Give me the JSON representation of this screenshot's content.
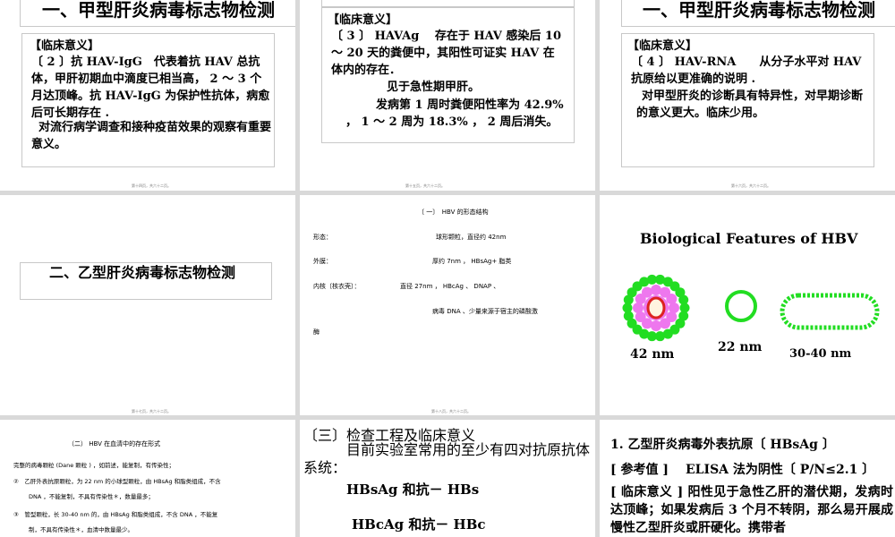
{
  "slide1": {
    "title": "一、甲型肝炎病毒标志物检测",
    "heading": "【临床意义】",
    "p1": "〔 2 〕抗 HAV-IgG　代表着抗 HAV 总抗体，甲肝初期血中滴度已相当高， 2 ～ 3 个月达顶峰。抗 HAV-IgG 为保护性抗体，病愈后可长期存在 .",
    "p2": "对流行病学调查和接种疫苗效果的观察有重要意义。",
    "footer": "第十四页，共六十二页。"
  },
  "slide2": {
    "heading": "【临床意义】",
    "p1": "〔 3 〕 HAVAg　 存在于 HAV 感染后 10 ～ 20 天的粪便中，其阳性可证实 HAV 在体内的存在．",
    "p2": "见于急性期甲肝。",
    "p3": "发病第 1 周时粪便阳性率为 42.9% ， 1 ～ 2 周为 18.3% ， 2 周后消失。",
    "footer": "第十五页，共六十二页。"
  },
  "slide3": {
    "title": "一、甲型肝炎病毒标志物检测",
    "heading": "【临床意义】",
    "p1": "〔 4 〕 HAV-RNA　　从分子水平对 HAV 抗原给以更准确的说明 .",
    "p2": "对甲型肝炎的诊断具有特异性，对早期诊断的意义更大。临床少用。",
    "footer": "第十六页，共六十二页。"
  },
  "slide4": {
    "title": "二、乙型肝炎病毒标志物检测",
    "footer": "第十七页，共六十二页。"
  },
  "slide5": {
    "title": "〔 一〕　HBV 的形态结构",
    "row1_label": "形态：",
    "row1_value": "球形颗粒，直径约 42nm",
    "row2_label": "外膜：",
    "row2_value": "厚约 7nm ， HBsAg+ 脂类",
    "row3_label": "内核〔核衣壳〕：",
    "row3_value": "直径 27nm ， HBcAg 、 DNAP 、",
    "row4": "病毒 DNA 、少量来源于宿主的磷酸激",
    "row5": "酶",
    "footer": "第十八页，共六十二页。"
  },
  "slide6": {
    "title": "Biological Features of HBV",
    "label1": "42 nm",
    "label2": "22 nm",
    "label3": "30-40 nm",
    "colors": {
      "outer": "#22dd22",
      "inner": "#ee77ee",
      "core": "#dd2222",
      "core_fill": "#fff4e0"
    }
  },
  "slide7": {
    "title": "（二） HBV 在血清中的存在形式",
    "p1": "完整的病毒颗粒 (Dane 颗粒 ) ，如前述，能复制，有传染性；",
    "p2a": "②　乙肝外表抗原颗粒，为 22 nm 的小球型颗粒，由 HBsAg 和脂类组成，不含",
    "p2b": "DNA ，不能复制，不具有传染性＊，数量最多；",
    "p3a": "③　管型颗粒，长 30-40 nm 的，由 HBsAg 和脂类组成，不含 DNA ，不能复",
    "p3b": "制，不具有传染性＊，血清中数量最少。",
    "footer": "第二十页，共六十二页。"
  },
  "slide8": {
    "title": "〔三〕检查工程及临床意义",
    "p1": "目前实验室常用的至少有四对抗原抗体系统：",
    "line1": "HBsAg 和抗－ HBs",
    "line2": "HBcAg 和抗－ HBc"
  },
  "slide9": {
    "title": "1. 乙型肝炎病毒外表抗原〔 HBsAg 〕",
    "ref_label": "[ 参考值 ]",
    "ref_value": "ELISA 法为阴性〔 P/N≤2.1 〕",
    "clin_label": "[ 临床意义 ]",
    "clin_text": "阳性见于急性乙肝的潜伏期，发病时达顶峰；如果发病后 3 个月不转阴，那么易开展成慢性乙型肝炎或肝硬化。携带者"
  }
}
